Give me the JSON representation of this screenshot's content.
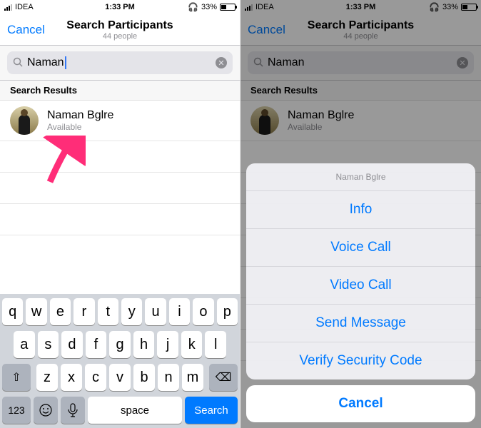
{
  "status": {
    "carrier": "IDEA",
    "time": "1:33 PM",
    "battery_pct": "33%"
  },
  "nav": {
    "cancel": "Cancel",
    "title": "Search Participants",
    "subtitle": "44 people"
  },
  "search": {
    "query": "Naman"
  },
  "section": {
    "header": "Search Results"
  },
  "result": {
    "name": "Naman Bglre",
    "status": "Available"
  },
  "keyboard": {
    "row1": [
      "q",
      "w",
      "e",
      "r",
      "t",
      "y",
      "u",
      "i",
      "o",
      "p"
    ],
    "row2": [
      "a",
      "s",
      "d",
      "f",
      "g",
      "h",
      "j",
      "k",
      "l"
    ],
    "row3": [
      "z",
      "x",
      "c",
      "v",
      "b",
      "n",
      "m"
    ],
    "shift": "⇧",
    "backspace": "⌫",
    "numkey": "123",
    "emoji": "😀",
    "mic": "🎤",
    "space": "space",
    "action": "Search"
  },
  "sheet": {
    "title": "Naman Bglre",
    "options": [
      "Info",
      "Voice Call",
      "Video Call",
      "Send Message",
      "Verify Security Code"
    ],
    "cancel": "Cancel"
  }
}
